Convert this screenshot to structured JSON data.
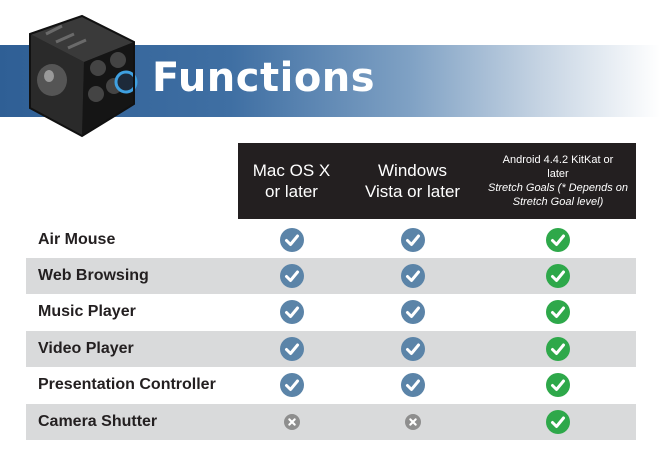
{
  "title": "Functions",
  "columns": [
    {
      "line1": "Mac OS X",
      "line2": "or later"
    },
    {
      "line1": "Windows",
      "line2": "Vista or later"
    },
    {
      "line1": "Android 4.4.2 KitKat or",
      "line2": "later",
      "note": "Stretch Goals (* Depends on Stretch Goal level)"
    }
  ],
  "rows": [
    {
      "label": "Air Mouse",
      "mac": "check",
      "windows": "check",
      "android": "check"
    },
    {
      "label": "Web Browsing",
      "mac": "check",
      "windows": "check",
      "android": "check"
    },
    {
      "label": "Music Player",
      "mac": "check",
      "windows": "check",
      "android": "check"
    },
    {
      "label": "Video Player",
      "mac": "check",
      "windows": "check",
      "android": "check"
    },
    {
      "label": "Presentation Controller",
      "mac": "check",
      "windows": "check",
      "android": "check"
    },
    {
      "label": "Camera Shutter",
      "mac": "cross",
      "windows": "cross",
      "android": "check"
    }
  ],
  "colors": {
    "banner": "#3f6fa3",
    "header_bg": "#231f20",
    "check_blue": "#5b84a8",
    "check_green": "#2ea84a",
    "cross_gray": "#8e8e8e",
    "row_shade": "#d9dadb"
  },
  "icons": {
    "check": "checkmark-circle-icon",
    "cross": "x-circle-icon",
    "logo": "fidget-cube-logo"
  }
}
